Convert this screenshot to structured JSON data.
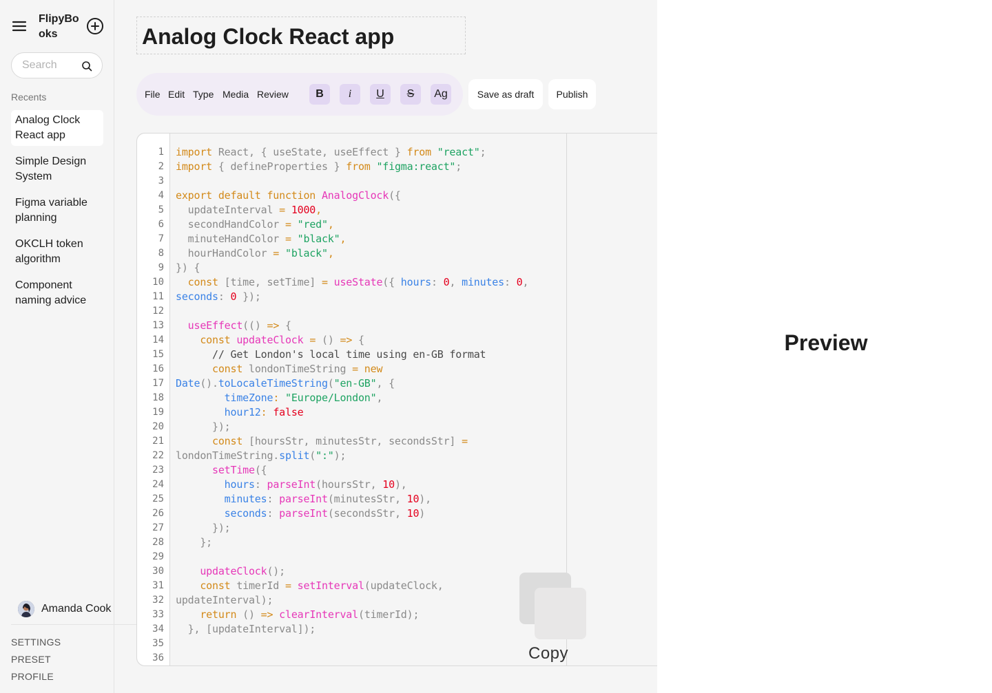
{
  "app": {
    "brand": "FlipyBooks"
  },
  "search": {
    "placeholder": "Search"
  },
  "sidebar": {
    "recents_label": "Recents",
    "recents": [
      {
        "label": "Analog Clock React app",
        "active": true
      },
      {
        "label": "Simple Design System",
        "active": false
      },
      {
        "label": "Figma variable planning",
        "active": false
      },
      {
        "label": "OKCLH token algorithm",
        "active": false
      },
      {
        "label": "Component naming advice",
        "active": false
      }
    ],
    "user": {
      "name": "Amanda Cook"
    },
    "footer": {
      "settings": "SETTINGS",
      "preset": "PRESET",
      "profile": "PROFILE"
    }
  },
  "document": {
    "title": "Analog Clock React app"
  },
  "toolbar": {
    "menus": [
      "File",
      "Edit",
      "Type",
      "Media",
      "Review"
    ],
    "format": {
      "bold": "B",
      "italic": "i",
      "underline": "U",
      "strike": "S",
      "text_style": "Ag"
    },
    "save_draft": "Save as draft",
    "publish": "Publish"
  },
  "editor": {
    "line_count": 36,
    "copy_label": "Copy",
    "lines": [
      [
        [
          "kw",
          "import"
        ],
        [
          "p",
          " React, { useState, useEffect } "
        ],
        [
          "kw",
          "from"
        ],
        [
          "p",
          " "
        ],
        [
          "str",
          "\"react\""
        ],
        [
          "p",
          ";"
        ]
      ],
      [
        [
          "kw",
          "import"
        ],
        [
          "p",
          " { defineProperties } "
        ],
        [
          "kw",
          "from"
        ],
        [
          "p",
          " "
        ],
        [
          "str",
          "\"figma:react\""
        ],
        [
          "p",
          ";"
        ]
      ],
      [],
      [
        [
          "kw",
          "export default function"
        ],
        [
          "p",
          " "
        ],
        [
          "fn",
          "AnalogClock"
        ],
        [
          "p",
          "({"
        ]
      ],
      [
        [
          "p",
          "  updateInterval "
        ],
        [
          "kw",
          "="
        ],
        [
          "p",
          " "
        ],
        [
          "num",
          "1000"
        ],
        [
          "kw",
          ","
        ]
      ],
      [
        [
          "p",
          "  secondHandColor "
        ],
        [
          "kw",
          "="
        ],
        [
          "p",
          " "
        ],
        [
          "str",
          "\"red\""
        ],
        [
          "kw",
          ","
        ]
      ],
      [
        [
          "p",
          "  minuteHandColor "
        ],
        [
          "kw",
          "="
        ],
        [
          "p",
          " "
        ],
        [
          "str",
          "\"black\""
        ],
        [
          "kw",
          ","
        ]
      ],
      [
        [
          "p",
          "  hourHandColor "
        ],
        [
          "kw",
          "="
        ],
        [
          "p",
          " "
        ],
        [
          "str",
          "\"black\""
        ],
        [
          "kw",
          ","
        ]
      ],
      [
        [
          "p",
          "}) {"
        ]
      ],
      [
        [
          "p",
          "  "
        ],
        [
          "kw",
          "const"
        ],
        [
          "p",
          " [time, setTime] "
        ],
        [
          "kw",
          "="
        ],
        [
          "p",
          " "
        ],
        [
          "fn",
          "useState"
        ],
        [
          "p",
          "({ "
        ],
        [
          "prop",
          "hours"
        ],
        [
          "p",
          ": "
        ],
        [
          "num",
          "0"
        ],
        [
          "p",
          ", "
        ],
        [
          "prop",
          "minutes"
        ],
        [
          "p",
          ": "
        ],
        [
          "num",
          "0"
        ],
        [
          "p",
          ","
        ]
      ],
      [
        [
          "prop",
          "seconds"
        ],
        [
          "p",
          ": "
        ],
        [
          "num",
          "0"
        ],
        [
          "p",
          " });"
        ]
      ],
      [],
      [
        [
          "p",
          "  "
        ],
        [
          "fn",
          "useEffect"
        ],
        [
          "p",
          "(() "
        ],
        [
          "kw",
          "=>"
        ],
        [
          "p",
          " {"
        ]
      ],
      [
        [
          "p",
          "    "
        ],
        [
          "kw",
          "const"
        ],
        [
          "p",
          " "
        ],
        [
          "fn",
          "updateClock"
        ],
        [
          "p",
          " "
        ],
        [
          "kw",
          "="
        ],
        [
          "p",
          " () "
        ],
        [
          "kw",
          "=>"
        ],
        [
          "p",
          " {"
        ]
      ],
      [
        [
          "p",
          "      "
        ],
        [
          "cmt",
          "// Get London's local time using en-GB format"
        ]
      ],
      [
        [
          "p",
          "      "
        ],
        [
          "kw",
          "const"
        ],
        [
          "p",
          " londonTimeString "
        ],
        [
          "kw",
          "= new"
        ]
      ],
      [
        [
          "prop",
          "Date"
        ],
        [
          "p",
          "()."
        ],
        [
          "prop",
          "toLocaleTimeString"
        ],
        [
          "p",
          "("
        ],
        [
          "str",
          "\"en-GB\""
        ],
        [
          "p",
          ", {"
        ]
      ],
      [
        [
          "p",
          "        "
        ],
        [
          "prop",
          "timeZone"
        ],
        [
          "kw",
          ":"
        ],
        [
          "p",
          " "
        ],
        [
          "str",
          "\"Europe/London\""
        ],
        [
          "p",
          ","
        ]
      ],
      [
        [
          "p",
          "        "
        ],
        [
          "prop",
          "hour12"
        ],
        [
          "kw",
          ":"
        ],
        [
          "p",
          " "
        ],
        [
          "num",
          "false"
        ]
      ],
      [
        [
          "p",
          "      });"
        ]
      ],
      [
        [
          "p",
          "      "
        ],
        [
          "kw",
          "const"
        ],
        [
          "p",
          " [hoursStr, minutesStr, secondsStr] "
        ],
        [
          "kw",
          "="
        ]
      ],
      [
        [
          "p",
          "londonTimeString."
        ],
        [
          "prop",
          "split"
        ],
        [
          "p",
          "("
        ],
        [
          "str",
          "\":\""
        ],
        [
          "p",
          ");"
        ]
      ],
      [
        [
          "p",
          "      "
        ],
        [
          "fn",
          "setTime"
        ],
        [
          "p",
          "({"
        ]
      ],
      [
        [
          "p",
          "        "
        ],
        [
          "prop",
          "hours"
        ],
        [
          "p",
          ": "
        ],
        [
          "fn",
          "parseInt"
        ],
        [
          "p",
          "(hoursStr, "
        ],
        [
          "num",
          "10"
        ],
        [
          "p",
          "),"
        ]
      ],
      [
        [
          "p",
          "        "
        ],
        [
          "prop",
          "minutes"
        ],
        [
          "p",
          ": "
        ],
        [
          "fn",
          "parseInt"
        ],
        [
          "p",
          "(minutesStr, "
        ],
        [
          "num",
          "10"
        ],
        [
          "p",
          "),"
        ]
      ],
      [
        [
          "p",
          "        "
        ],
        [
          "prop",
          "seconds"
        ],
        [
          "p",
          ": "
        ],
        [
          "fn",
          "parseInt"
        ],
        [
          "p",
          "(secondsStr, "
        ],
        [
          "num",
          "10"
        ],
        [
          "p",
          ")"
        ]
      ],
      [
        [
          "p",
          "      });"
        ]
      ],
      [
        [
          "p",
          "    };"
        ]
      ],
      [],
      [
        [
          "p",
          "    "
        ],
        [
          "fn",
          "updateClock"
        ],
        [
          "p",
          "();"
        ]
      ],
      [
        [
          "p",
          "    "
        ],
        [
          "kw",
          "const"
        ],
        [
          "p",
          " timerId "
        ],
        [
          "kw",
          "="
        ],
        [
          "p",
          " "
        ],
        [
          "fn",
          "setInterval"
        ],
        [
          "p",
          "(updateClock,"
        ]
      ],
      [
        [
          "p",
          "updateInterval);"
        ]
      ],
      [
        [
          "p",
          "    "
        ],
        [
          "kw",
          "return"
        ],
        [
          "p",
          " () "
        ],
        [
          "kw",
          "=>"
        ],
        [
          "p",
          " "
        ],
        [
          "fn",
          "clearInterval"
        ],
        [
          "p",
          "(timerId);"
        ]
      ],
      [
        [
          "p",
          "  }, [updateInterval]);"
        ]
      ],
      [],
      []
    ]
  },
  "preview": {
    "title": "Preview"
  },
  "colors": {
    "keyword": "#d38a1a",
    "string": "#1ea362",
    "function": "#e637b8",
    "number": "#e4001e",
    "property": "#3a82e6",
    "toolbar_bg": "#f1ecf6",
    "format_button_bg": "#e2d7f2"
  }
}
